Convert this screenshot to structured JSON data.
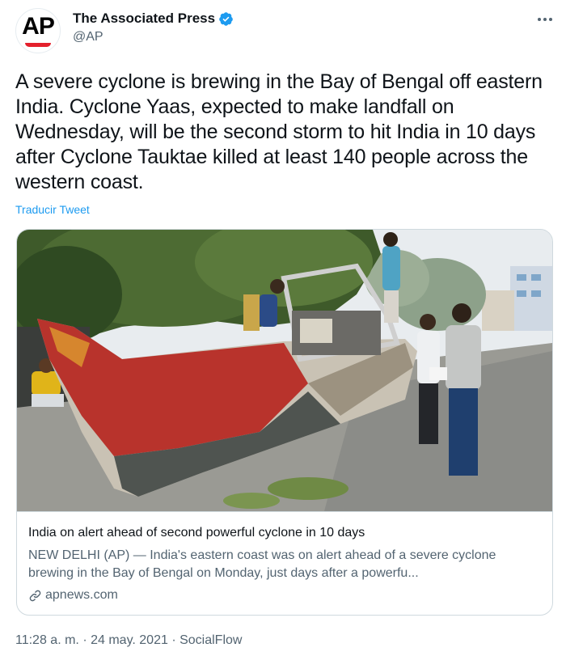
{
  "author": {
    "avatar_text": "AP",
    "name": "The Associated Press",
    "handle": "@AP",
    "verified": true,
    "more_icon": "more-horizontal-icon"
  },
  "tweet": {
    "text": "A severe cyclone is brewing in the Bay of Bengal off eastern India. Cyclone Yaas, expected to make landfall on Wednesday, will be the second storm to hit India in 10 days after Cyclone Tauktae killed at least 140 people across the western coast.",
    "translate_label": "Traducir Tweet"
  },
  "card": {
    "title": "India on alert ahead of second powerful cyclone in 10 days",
    "description": "NEW DELHI (AP) — India's eastern coast was on alert ahead of a severe cyclone brewing in the Bay of Bengal on Monday, just days after a powerfu...",
    "domain": "apnews.com",
    "link_icon": "link-icon"
  },
  "meta": {
    "time": "11:28 a. m.",
    "separator": "·",
    "date": "24 may. 2021",
    "source": "SocialFlow"
  },
  "colors": {
    "link": "#1d9bf0",
    "secondary_text": "#536471",
    "border": "#cfd9de",
    "verified_badge": "#1d9bf0",
    "ap_red": "#e4202c"
  }
}
